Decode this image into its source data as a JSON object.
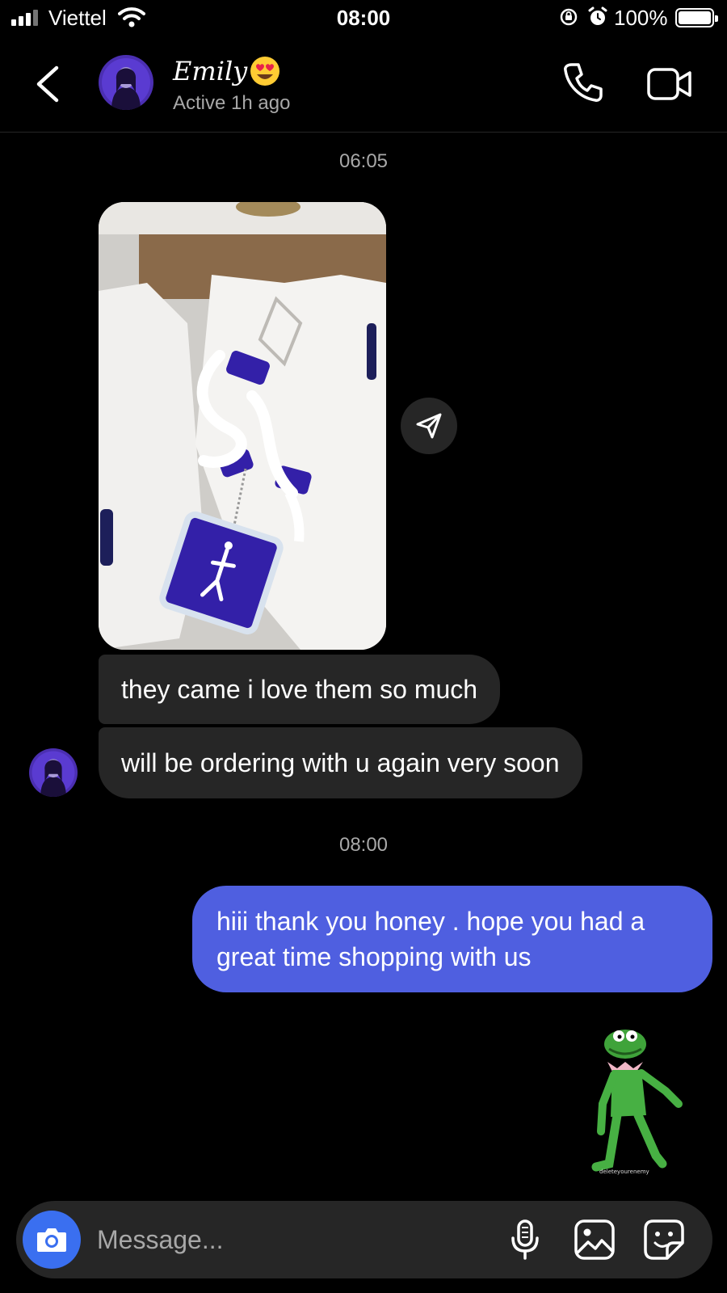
{
  "status_bar": {
    "carrier": "Viettel",
    "time": "08:00",
    "battery_percent": "100%",
    "icons": [
      "signal-icon",
      "wifi-icon",
      "rotation-lock-icon",
      "alarm-icon",
      "battery-icon"
    ]
  },
  "header": {
    "name": "Emily",
    "status": "Active 1h ago",
    "icons": [
      "back-icon",
      "heart-eyes-emoji",
      "phone-icon",
      "video-icon"
    ]
  },
  "thread": {
    "timestamp_1": "06:05",
    "incoming_1": "they came i love them so much",
    "incoming_2": "will be ordering with u again very soon",
    "timestamp_2": "08:00",
    "outgoing_1": "hiii thank you honey . hope you had a great time shopping with us",
    "sticker_caption": "deleteyourenemy"
  },
  "composer": {
    "placeholder": "Message...",
    "icons": [
      "camera-icon",
      "microphone-icon",
      "gallery-icon",
      "sticker-icon"
    ]
  },
  "colors": {
    "background": "#000000",
    "incoming_bubble": "#262626",
    "outgoing_bubble": "#4f5fe0",
    "camera_button": "#3a6ff0",
    "muted_text": "#a8a8a8"
  }
}
